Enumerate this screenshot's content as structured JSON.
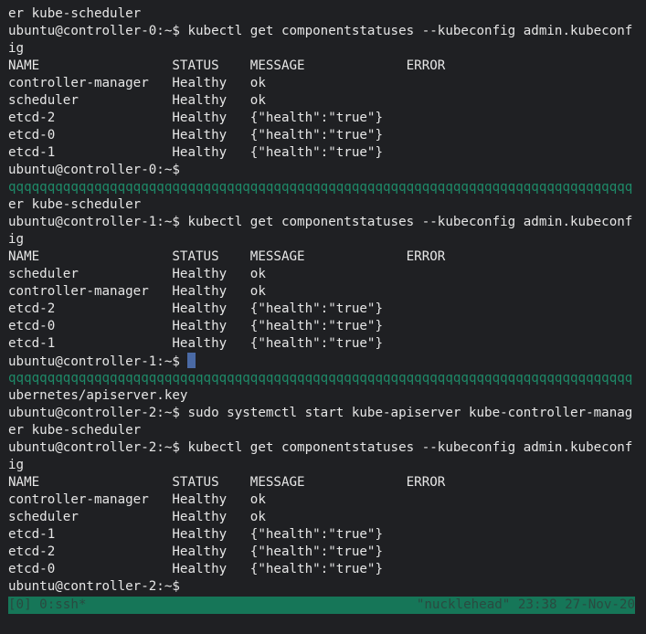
{
  "pane0": {
    "lines": [
      "er kube-scheduler",
      "ubuntu@controller-0:~$ kubectl get componentstatuses --kubeconfig admin.kubeconf",
      "ig",
      "NAME                 STATUS    MESSAGE             ERROR",
      "controller-manager   Healthy   ok",
      "scheduler            Healthy   ok",
      "etcd-2               Healthy   {\"health\":\"true\"}",
      "etcd-0               Healthy   {\"health\":\"true\"}",
      "etcd-1               Healthy   {\"health\":\"true\"}",
      "ubuntu@controller-0:~$"
    ]
  },
  "separator": "qqqqqqqqqqqqqqqqqqqqqqqqqqqqqqqqqqqqqqqqqqqqqqqqqqqqqqqqqqqqqqqqqqqqqqqqqqqqqqqq",
  "pane1": {
    "lines": [
      "er kube-scheduler",
      "ubuntu@controller-1:~$ kubectl get componentstatuses --kubeconfig admin.kubeconf",
      "ig",
      "NAME                 STATUS    MESSAGE             ERROR",
      "scheduler            Healthy   ok",
      "controller-manager   Healthy   ok",
      "etcd-2               Healthy   {\"health\":\"true\"}",
      "etcd-0               Healthy   {\"health\":\"true\"}",
      "etcd-1               Healthy   {\"health\":\"true\"}"
    ],
    "prompt": "ubuntu@controller-1:~$ "
  },
  "pane2": {
    "lines": [
      "ubernetes/apiserver.key",
      "ubuntu@controller-2:~$ sudo systemctl start kube-apiserver kube-controller-manag",
      "er kube-scheduler",
      "ubuntu@controller-2:~$ kubectl get componentstatuses --kubeconfig admin.kubeconf",
      "ig",
      "NAME                 STATUS    MESSAGE             ERROR",
      "controller-manager   Healthy   ok",
      "scheduler            Healthy   ok",
      "etcd-1               Healthy   {\"health\":\"true\"}",
      "etcd-2               Healthy   {\"health\":\"true\"}",
      "etcd-0               Healthy   {\"health\":\"true\"}",
      "ubuntu@controller-2:~$"
    ]
  },
  "statusbar": {
    "left": "[0] 0:ssh*",
    "right": "\"nucklehead\" 23:38 27-Nov-20"
  },
  "colors": {
    "background": "#1f2023",
    "separator": "#1e8a68",
    "statusbar_bg": "#167658",
    "cursor": "#4a6aa5"
  }
}
